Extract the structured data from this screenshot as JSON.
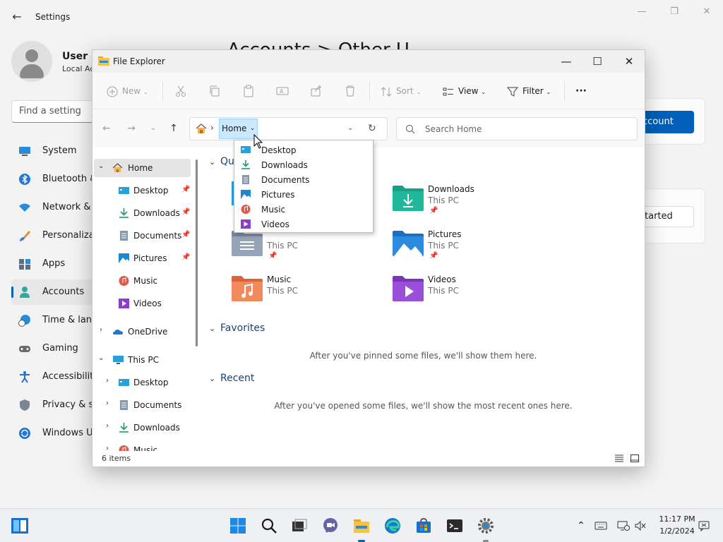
{
  "settings": {
    "title": "Settings",
    "user_name": "User",
    "user_sub": "Local Ac",
    "heading": "Accounts  >  Other U",
    "search_placeholder": "Find a setting",
    "nav": [
      {
        "label": "System",
        "icon": "monitor-icon"
      },
      {
        "label": "Bluetooth &",
        "icon": "bluetooth-icon"
      },
      {
        "label": "Network &",
        "icon": "wifi-icon"
      },
      {
        "label": "Personaliza",
        "icon": "brush-icon"
      },
      {
        "label": "Apps",
        "icon": "apps-icon"
      },
      {
        "label": "Accounts",
        "icon": "person-icon"
      },
      {
        "label": "Time & lang",
        "icon": "clock-globe-icon"
      },
      {
        "label": "Gaming",
        "icon": "gamepad-icon"
      },
      {
        "label": "Accessibility",
        "icon": "accessibility-icon"
      },
      {
        "label": "Privacy & se",
        "icon": "shield-icon"
      },
      {
        "label": "Windows U",
        "icon": "update-icon"
      }
    ],
    "add_account_label": "ccount",
    "get_started_label": "tarted"
  },
  "explorer": {
    "title": "File Explorer",
    "toolbar": {
      "new_label": "New",
      "sort_label": "Sort",
      "view_label": "View",
      "filter_label": "Filter",
      "more_label": "···"
    },
    "address": {
      "crumb": "Home",
      "search_placeholder": "Search Home"
    },
    "nav_pane": {
      "home": "Home",
      "quick": [
        {
          "label": "Desktop",
          "pinned": true
        },
        {
          "label": "Downloads",
          "pinned": true
        },
        {
          "label": "Documents",
          "pinned": true
        },
        {
          "label": "Pictures",
          "pinned": true
        },
        {
          "label": "Music",
          "pinned": false
        },
        {
          "label": "Videos",
          "pinned": false
        }
      ],
      "onedrive": "OneDrive",
      "thispc": "This PC",
      "thispc_children": [
        "Desktop",
        "Documents",
        "Downloads",
        "Music"
      ]
    },
    "content": {
      "quick_access_title": "Qu",
      "tiles": [
        {
          "name": "Downloads",
          "sub": "This PC",
          "pinned": true
        },
        {
          "name": "",
          "sub": "This PC",
          "pinned": true
        },
        {
          "name": "Pictures",
          "sub": "This PC",
          "pinned": true
        },
        {
          "name": "Music",
          "sub": "This PC",
          "pinned": false
        },
        {
          "name": "Videos",
          "sub": "This PC",
          "pinned": false
        }
      ],
      "favorites_title": "Favorites",
      "favorites_empty": "After you've pinned some files, we'll show them here.",
      "recent_title": "Recent",
      "recent_empty": "After you've opened some files, we'll show the most recent ones here."
    },
    "status": {
      "items": "6 items"
    },
    "dropdown": [
      "Desktop",
      "Downloads",
      "Documents",
      "Pictures",
      "Music",
      "Videos"
    ]
  },
  "taskbar": {
    "time": "11:17 PM",
    "date": "1/2/2024"
  },
  "colors": {
    "accent": "#005fb8",
    "selection": "#cce8ff",
    "folder_yellow": "#f5c443"
  }
}
